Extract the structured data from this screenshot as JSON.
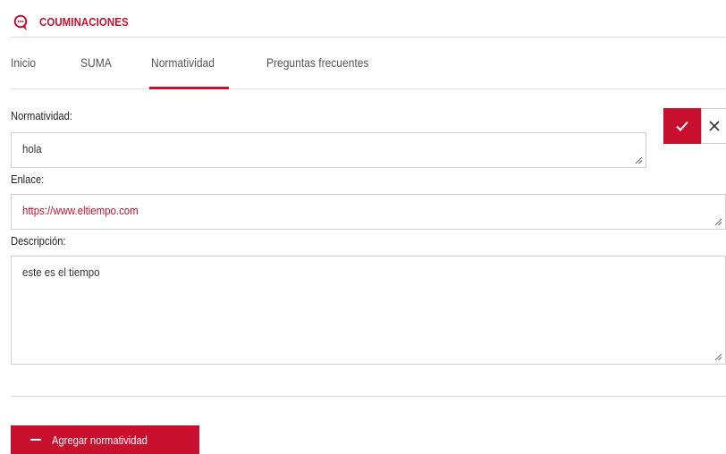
{
  "colors": {
    "accent": "#c8102e",
    "border": "#cfcfcf"
  },
  "header": {
    "title": "COUMINACIONES",
    "icon": "chat-bubble-icon"
  },
  "tabs": [
    {
      "label": "Inicio",
      "active": false
    },
    {
      "label": "SUMA",
      "active": false
    },
    {
      "label": "Normatividad",
      "active": true
    },
    {
      "label": "Preguntas frecuentes",
      "active": false
    }
  ],
  "form": {
    "normatividad": {
      "label": "Normatividad:",
      "value": "hola"
    },
    "enlace": {
      "label": "Enlace:",
      "value": "https://www.eltiempo.com"
    },
    "descripcion": {
      "label": "Descripción:",
      "value": "este es el tiempo"
    }
  },
  "actions": {
    "confirm_icon": "check-icon",
    "cancel_icon": "close-icon"
  },
  "add_button": {
    "label": "Agregar normatividad",
    "icon": "minus-icon"
  }
}
